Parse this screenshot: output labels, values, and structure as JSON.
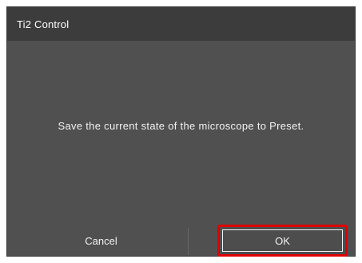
{
  "window": {
    "title": "Ti2 Control"
  },
  "dialog": {
    "message": "Save the current state of the microscope to Preset."
  },
  "buttons": {
    "cancel_label": "Cancel",
    "ok_label": "OK"
  },
  "colors": {
    "title_bar": "#3c3c3c",
    "body": "#505050",
    "text": "#f2f2f2",
    "highlight": "#e00000"
  }
}
